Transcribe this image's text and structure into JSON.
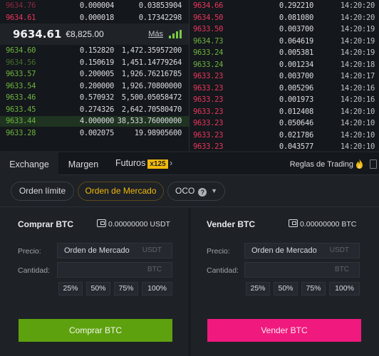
{
  "order_book": {
    "asks": [
      {
        "price": "9634.76",
        "amount": "0.000004",
        "total": "0.03853904",
        "dim": true
      },
      {
        "price": "9634.61",
        "amount": "0.000018",
        "total": "0.17342298",
        "dim": false
      }
    ],
    "last_price": "9634.61",
    "fiat_price": "€8,825.00",
    "more_label": "Más",
    "bids": [
      {
        "price": "9634.60",
        "amount": "0.152820",
        "total": "1,472.35957200",
        "dim": false
      },
      {
        "price": "9634.56",
        "amount": "0.150619",
        "total": "1,451.14779264",
        "dim": true
      },
      {
        "price": "9633.57",
        "amount": "0.200005",
        "total": "1,926.76216785",
        "dim": false
      },
      {
        "price": "9633.54",
        "amount": "0.200000",
        "total": "1,926.70800000",
        "dim": false
      },
      {
        "price": "9633.46",
        "amount": "0.570932",
        "total": "5,500.05058472",
        "dim": false
      },
      {
        "price": "9633.45",
        "amount": "0.274326",
        "total": "2,642.70580470",
        "dim": false
      },
      {
        "price": "9633.44",
        "amount": "4.000000",
        "total": "38,533.76000000",
        "dim": false
      },
      {
        "price": "9633.28",
        "amount": "0.002075",
        "total": "19.98905600",
        "dim": false
      }
    ]
  },
  "trades": [
    {
      "price": "9634.66",
      "amount": "0.292210",
      "time": "14:20:20",
      "side": "sell"
    },
    {
      "price": "9634.50",
      "amount": "0.081080",
      "time": "14:20:20",
      "side": "sell"
    },
    {
      "price": "9633.50",
      "amount": "0.003700",
      "time": "14:20:19",
      "side": "sell"
    },
    {
      "price": "9634.73",
      "amount": "0.064619",
      "time": "14:20:19",
      "side": "buy"
    },
    {
      "price": "9633.24",
      "amount": "0.005381",
      "time": "14:20:19",
      "side": "buy"
    },
    {
      "price": "9633.24",
      "amount": "0.001234",
      "time": "14:20:18",
      "side": "buy"
    },
    {
      "price": "9633.23",
      "amount": "0.003700",
      "time": "14:20:17",
      "side": "sell"
    },
    {
      "price": "9633.23",
      "amount": "0.005296",
      "time": "14:20:16",
      "side": "sell"
    },
    {
      "price": "9633.23",
      "amount": "0.001973",
      "time": "14:20:16",
      "side": "sell"
    },
    {
      "price": "9633.23",
      "amount": "0.012408",
      "time": "14:20:10",
      "side": "sell"
    },
    {
      "price": "9633.23",
      "amount": "0.050646",
      "time": "14:20:10",
      "side": "sell"
    },
    {
      "price": "9633.23",
      "amount": "0.021786",
      "time": "14:20:10",
      "side": "sell"
    },
    {
      "price": "9633.23",
      "amount": "0.043577",
      "time": "14:20:10",
      "side": "sell"
    }
  ],
  "tabs": {
    "exchange": "Exchange",
    "margin": "Margen",
    "futures": "Futuros",
    "futures_badge": "x125",
    "chevron": "›",
    "rules": "Reglas de Trading"
  },
  "order_types": {
    "limit": "Orden límite",
    "market": "Orden de Mercado",
    "oco": "OCO",
    "help": "?",
    "dropdown": "▼"
  },
  "buy_form": {
    "title": "Comprar BTC",
    "balance": "0.00000000 USDT",
    "price_label": "Precio:",
    "price_value": "Orden de Mercado",
    "price_unit": "USDT",
    "qty_label": "Cantidad:",
    "qty_unit": "BTC",
    "pcts": [
      "25%",
      "50%",
      "75%",
      "100%"
    ],
    "button": "Comprar BTC"
  },
  "sell_form": {
    "title": "Vender BTC",
    "balance": "0.00000000 BTC",
    "price_label": "Precio:",
    "price_value": "Orden de Mercado",
    "price_unit": "USDT",
    "qty_label": "Cantidad:",
    "qty_unit": "BTC",
    "pcts": [
      "25%",
      "50%",
      "75%",
      "100%"
    ],
    "button": "Vender BTC"
  },
  "colors": {
    "buy": "#5ea10f",
    "sell": "#f0197e",
    "accent": "#f0b90b",
    "ask_text": "#e8365d",
    "bid_text": "#6db33f"
  }
}
